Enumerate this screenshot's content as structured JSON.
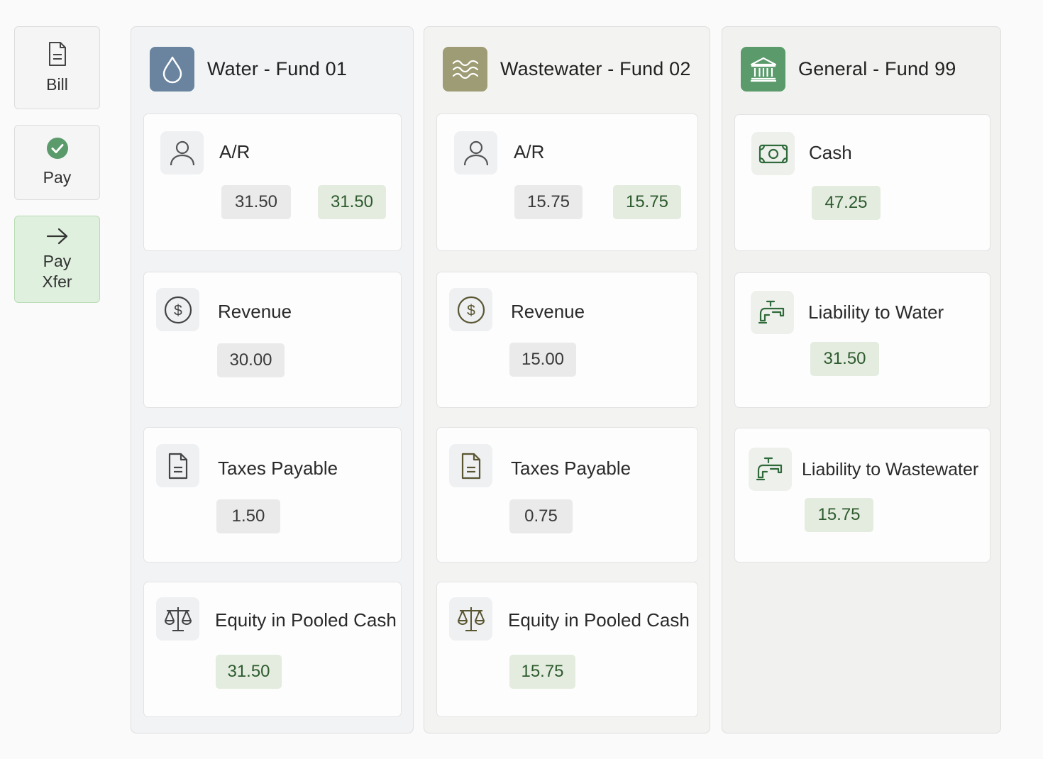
{
  "sidebar": {
    "bill": {
      "label": "Bill",
      "icon": "document-icon"
    },
    "pay": {
      "label": "Pay",
      "icon": "check-circle-icon"
    },
    "pay_xfer": {
      "label_line1": "Pay",
      "label_line2": "Xfer",
      "icon": "arrow-right-icon",
      "active": true
    }
  },
  "funds": [
    {
      "title": "Water - Fund 01",
      "icon": "water-drop-icon",
      "accounts": {
        "ar": {
          "name": "A/R",
          "icon": "person-icon",
          "debit": "31.50",
          "credit": "31.50"
        },
        "revenue": {
          "name": "Revenue",
          "icon": "dollar-circle-icon",
          "debit": "30.00"
        },
        "taxes": {
          "name": "Taxes Payable",
          "icon": "document-icon",
          "debit": "1.50"
        },
        "equity": {
          "name": "Equity in Pooled Cash",
          "icon": "scales-icon",
          "credit": "31.50"
        }
      }
    },
    {
      "title": "Wastewater - Fund 02",
      "icon": "waves-icon",
      "accounts": {
        "ar": {
          "name": "A/R",
          "icon": "person-icon",
          "debit": "15.75",
          "credit": "15.75"
        },
        "revenue": {
          "name": "Revenue",
          "icon": "dollar-circle-icon",
          "debit": "15.00"
        },
        "taxes": {
          "name": "Taxes Payable",
          "icon": "document-icon",
          "debit": "0.75"
        },
        "equity": {
          "name": "Equity in Pooled Cash",
          "icon": "scales-icon",
          "credit": "15.75"
        }
      }
    },
    {
      "title": "General - Fund 99",
      "icon": "bank-icon",
      "accounts": {
        "cash": {
          "name": "Cash",
          "icon": "cash-icon",
          "credit": "47.25"
        },
        "liab_water": {
          "name": "Liability to Water",
          "icon": "faucet-icon",
          "credit": "31.50"
        },
        "liab_ww": {
          "name": "Liability to Wastewater",
          "icon": "faucet-icon",
          "credit": "15.75"
        }
      }
    }
  ],
  "colors": {
    "water": "#6a84a0",
    "wastewater": "#9e9c74",
    "general": "#5a9a6b",
    "credit_chip": "#e3ecdf",
    "credit_text": "#2e5b2e",
    "debit_chip": "#eaeaea",
    "active_button": "#dff0de"
  }
}
